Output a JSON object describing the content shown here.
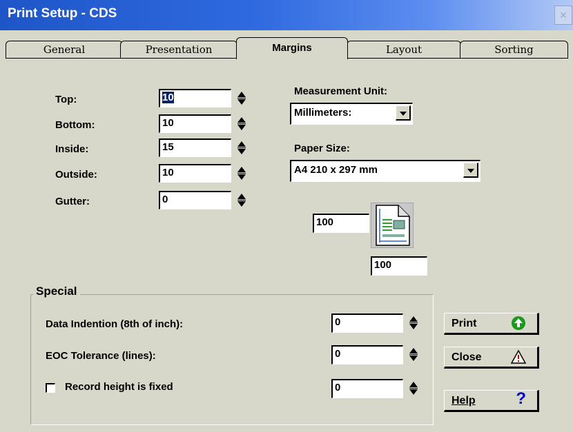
{
  "window": {
    "title": "Print Setup - CDS",
    "close_symbol": "×"
  },
  "tabs": [
    {
      "label": "General"
    },
    {
      "label": "Presentation"
    },
    {
      "label": "Margins",
      "active": true
    },
    {
      "label": "Layout"
    },
    {
      "label": "Sorting"
    }
  ],
  "margins": {
    "top": {
      "label": "Top:",
      "value": "10"
    },
    "bottom": {
      "label": "Bottom:",
      "value": "10"
    },
    "inside": {
      "label": "Inside:",
      "value": "15"
    },
    "outside": {
      "label": "Outside:",
      "value": "10"
    },
    "gutter": {
      "label": "Gutter:",
      "value": "0"
    }
  },
  "measurement": {
    "label": "Measurement Unit:",
    "value": "Millimeters:"
  },
  "paper": {
    "label": "Paper Size:",
    "value": "A4 210 x 297 mm",
    "scale_x": "100",
    "scale_y": "100"
  },
  "special": {
    "title": "Special",
    "data_indention": {
      "label": "Data Indention (8th of inch):",
      "value": "0"
    },
    "eoc_tolerance": {
      "label": "EOC Tolerance (lines):",
      "value": "0"
    },
    "record_height": {
      "label": "Record height is fixed",
      "value": "0",
      "checked": false
    }
  },
  "buttons": {
    "print": {
      "label": "Print",
      "icon": "green-up-arrow-icon"
    },
    "close": {
      "label": "Close",
      "icon": "warning-triangle-icon"
    },
    "help": {
      "label": "Help",
      "icon": "question-mark-icon"
    }
  },
  "colors": {
    "title_bar": "#2f6ae0",
    "dialog_bg": "#d8d8ca",
    "selection": "#0a246a",
    "print_icon": "#1a9a1a",
    "help_icon": "#0000cc"
  }
}
